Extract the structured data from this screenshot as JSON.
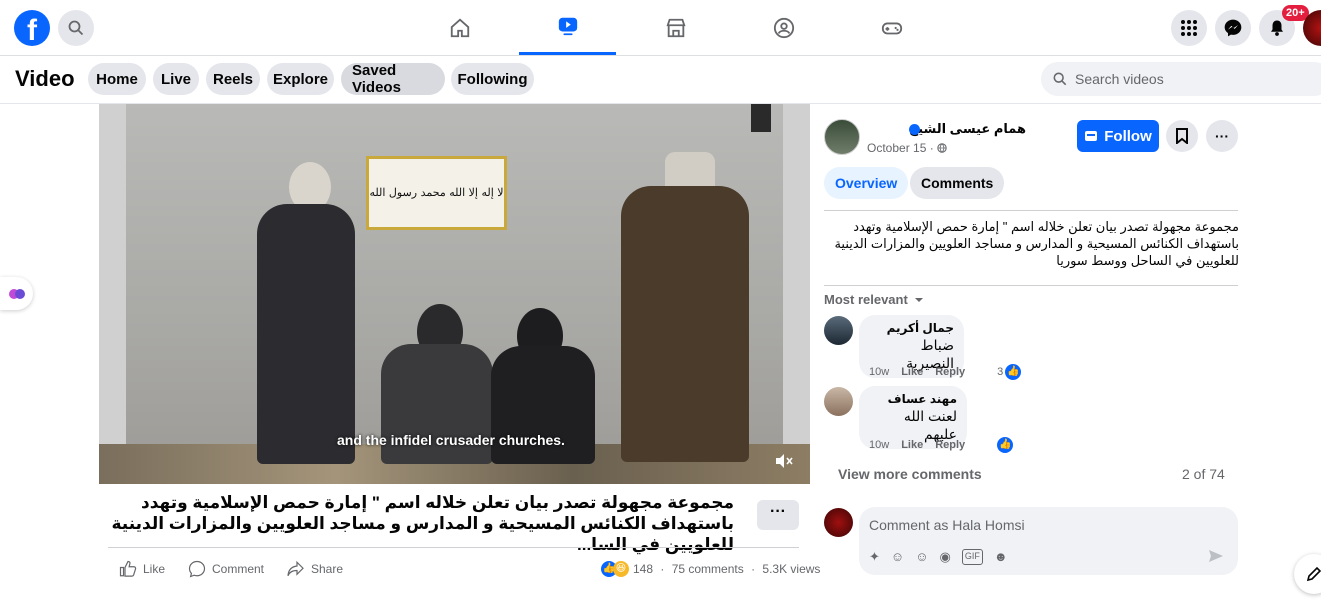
{
  "app": {
    "name": "Facebook"
  },
  "topbar": {
    "notification_badge": "20+",
    "nav_tabs": [
      {
        "name": "home-icon"
      },
      {
        "name": "video-icon",
        "active": true
      },
      {
        "name": "marketplace-icon"
      },
      {
        "name": "groups-icon"
      },
      {
        "name": "gaming-icon"
      }
    ],
    "accent": "#0866ff"
  },
  "video_header": {
    "title": "Video",
    "tabs": [
      "Home",
      "Live",
      "Reels",
      "Explore",
      "Saved Videos",
      "Following"
    ],
    "active_tab": "Saved Videos",
    "search_placeholder": "Search videos"
  },
  "video": {
    "caption": "and the infidel crusader churches.",
    "flag_text": "لا إله إلا الله محمد رسول الله"
  },
  "post": {
    "title": "مجموعة مجهولة تصدر بيان تعلن خلاله اسم \" إمارة حمص الإسلامية وتهدد باستهداف الكنائس المسيحية و المدارس و مساجد العلويين والمزارات الدينية للعلويين في السا...",
    "more": "···",
    "actions": {
      "like": "Like",
      "comment": "Comment",
      "share": "Share"
    },
    "reactions_count": "148",
    "comments_count": "75 comments",
    "views": "5.3K views"
  },
  "author": {
    "name": "همام عيسى الشيخ",
    "date": "October 15 ·",
    "follow_label": "Follow",
    "more": "···"
  },
  "panel_tabs": {
    "overview": "Overview",
    "comments": "Comments"
  },
  "description": "مجموعة مجهولة تصدر بيان تعلن خلاله اسم \" إمارة حمص الإسلامية وتهدد باستهداف الكنائس المسيحية و المدارس و مساجد العلويين والمزارات الدينية للعلويين في الساحل ووسط سوريا",
  "comments_section": {
    "sort_label": "Most relevant",
    "comments": [
      {
        "author": "جمال أكريم",
        "text": "ضباط النصيرية",
        "time": "10w",
        "like": "Like",
        "reply": "Reply",
        "reactions": "3"
      },
      {
        "author": "مهند عساف",
        "text": "لعنت الله عليهم",
        "time": "10w",
        "like": "Like",
        "reply": "Reply",
        "reactions": ""
      }
    ],
    "view_more": "View more comments",
    "pager": "2 of 74",
    "composer_placeholder": "Comment as Hala Homsi"
  }
}
